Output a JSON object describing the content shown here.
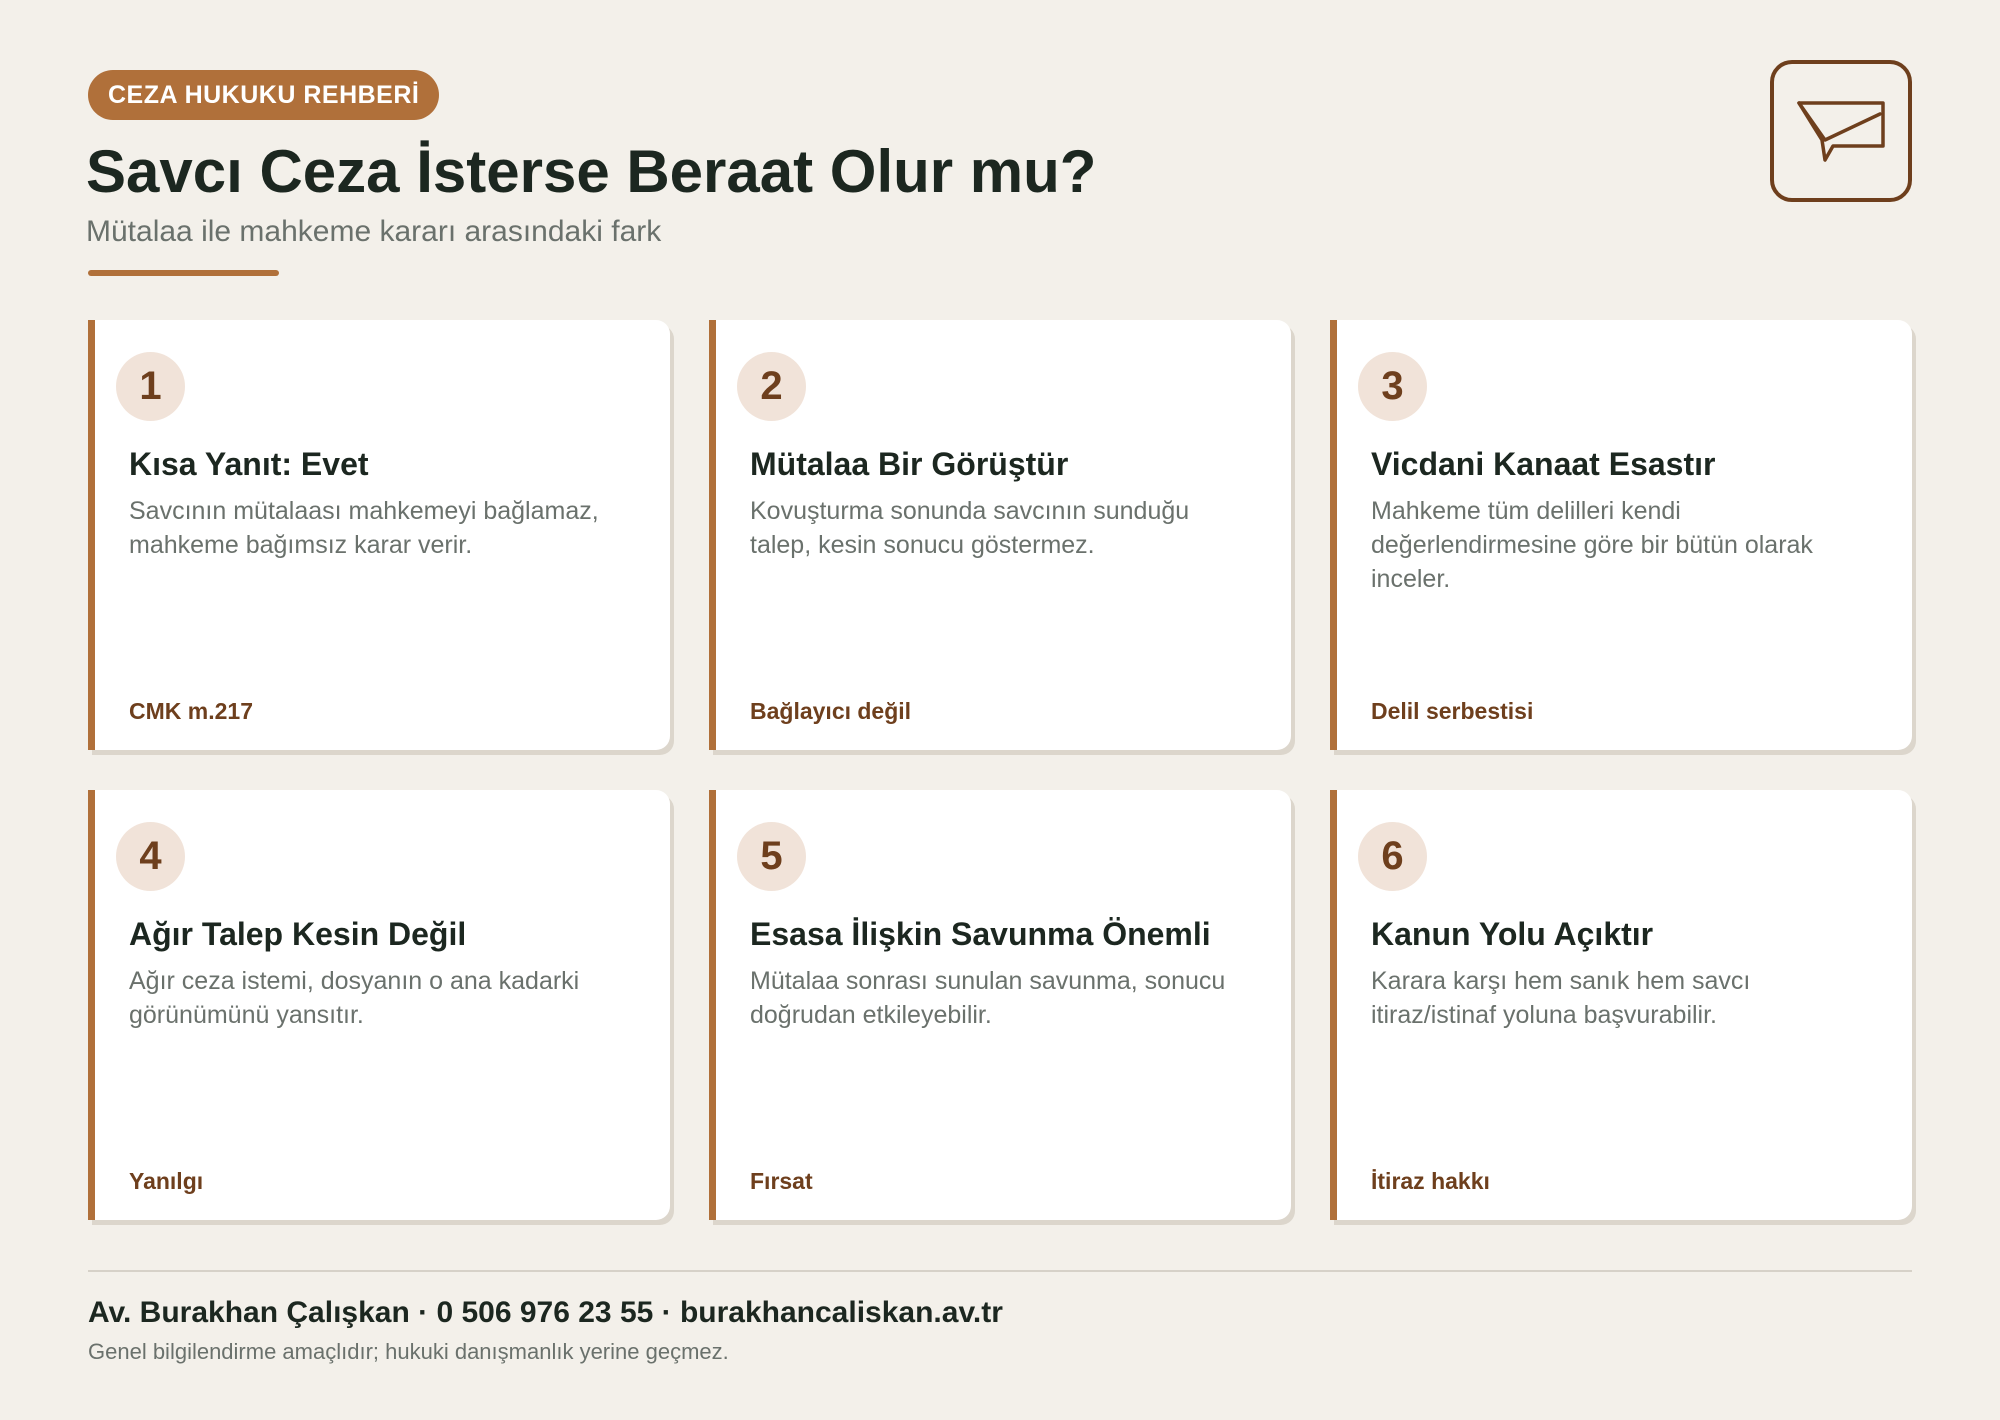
{
  "header": {
    "badge": "CEZA HUKUKU REHBERİ",
    "title": "Savcı Ceza İsterse Beraat Olur mu?",
    "subtitle": "Mütalaa ile mahkeme kararı arasındaki fark",
    "icon": "message-icon"
  },
  "colors": {
    "background": "#f3f0ea",
    "accent": "#b0703a",
    "accent_dark": "#6e3f1d",
    "number_bg": "#f1e3d9",
    "text": "#1c2720",
    "muted": "#6a716c"
  },
  "cards": [
    {
      "number": "1",
      "title": "Kısa Yanıt: Evet",
      "description": "Savcının mütalaası mahkemeyi bağlamaz, mahkeme bağımsız karar verir.",
      "tag": "CMK m.217"
    },
    {
      "number": "2",
      "title": "Mütalaa Bir Görüştür",
      "description": "Kovuşturma sonunda savcının sunduğu talep, kesin sonucu göstermez.",
      "tag": "Bağlayıcı değil"
    },
    {
      "number": "3",
      "title": "Vicdani Kanaat Esastır",
      "description": "Mahkeme tüm delilleri kendi değerlendirmesine göre bir bütün olarak inceler.",
      "tag": "Delil serbestisi"
    },
    {
      "number": "4",
      "title": "Ağır Talep Kesin Değil",
      "description": "Ağır ceza istemi, dosyanın o ana kadarki görünümünü yansıtır.",
      "tag": "Yanılgı"
    },
    {
      "number": "5",
      "title": "Esasa İlişkin Savunma Önemli",
      "description": "Mütalaa sonrası sunulan savunma, sonucu doğrudan etkileyebilir.",
      "tag": "Fırsat"
    },
    {
      "number": "6",
      "title": "Kanun Yolu Açıktır",
      "description": "Karara karşı hem sanık hem savcı itiraz/istinaf yoluna başvurabilir.",
      "tag": "İtiraz hakkı"
    }
  ],
  "footer": {
    "contact": "Av. Burakhan Çalışkan · 0 506 976 23 55 · burakhancaliskan.av.tr",
    "disclaimer": "Genel bilgilendirme amaçlıdır; hukuki danışmanlık yerine geçmez."
  }
}
